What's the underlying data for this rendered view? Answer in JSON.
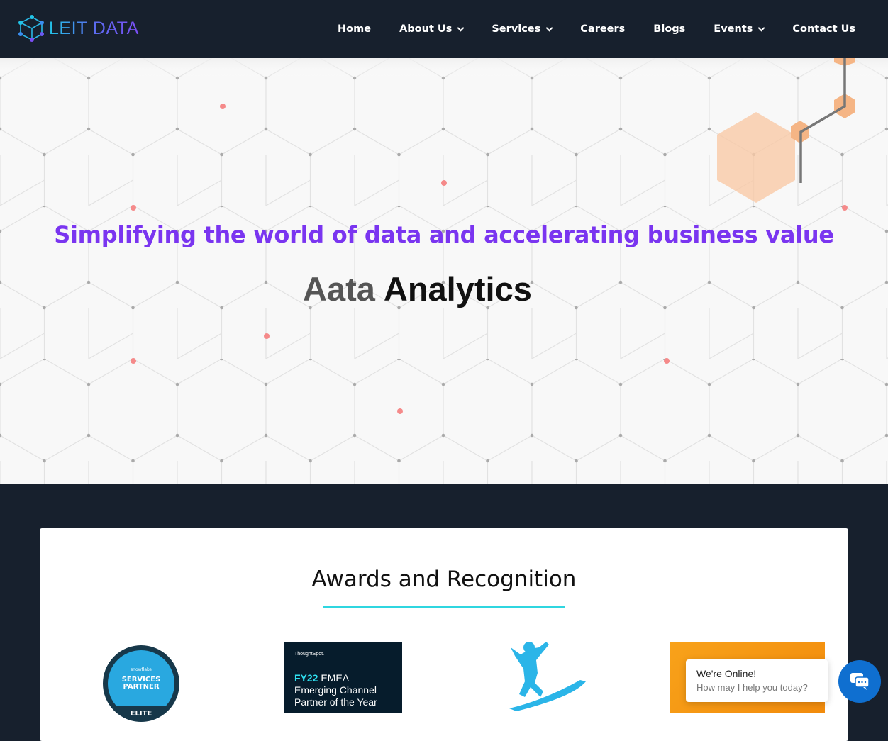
{
  "brand": {
    "name": "LEIT DATA"
  },
  "nav": {
    "items": [
      {
        "label": "Home",
        "dropdown": false
      },
      {
        "label": "About Us",
        "dropdown": true
      },
      {
        "label": "Services",
        "dropdown": true
      },
      {
        "label": "Careers",
        "dropdown": false
      },
      {
        "label": "Blogs",
        "dropdown": false
      },
      {
        "label": "Events",
        "dropdown": true
      },
      {
        "label": "Contact Us",
        "dropdown": false
      }
    ]
  },
  "hero": {
    "tagline": "Simplifying the world of data and accelerating business value",
    "typing_text": "Aata",
    "headline_word": "Analytics"
  },
  "awards": {
    "title": "Awards and Recognition",
    "badge1": {
      "brand": "snowflake",
      "line1": "SERVICES",
      "line2": "PARTNER",
      "line3": "ELITE"
    },
    "badge2": {
      "brand": "ThoughtSpot.",
      "fy": "FY22",
      "line1": " EMEA",
      "line2": "Emerging Channel",
      "line3": "Partner of the Year"
    }
  },
  "chat": {
    "title": "We're Online!",
    "subtitle": "How may I help you today?"
  },
  "colors": {
    "nav_bg": "#17202d",
    "accent_purple": "#7a35f0",
    "accent_cyan": "#2fd6e0",
    "chat_blue": "#0f6fd0"
  }
}
